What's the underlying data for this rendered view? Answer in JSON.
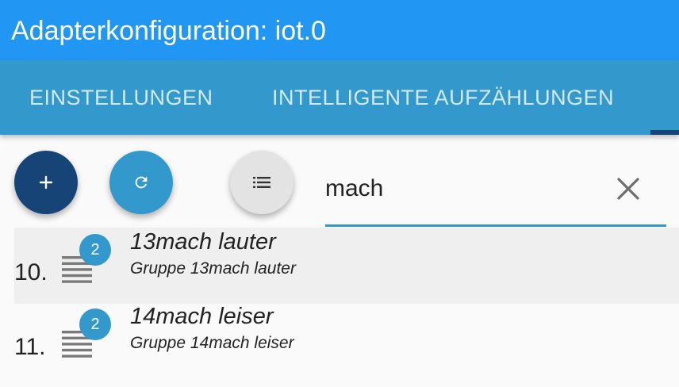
{
  "window": {
    "title": "Adapterkonfiguration: iot.0"
  },
  "tabs": [
    {
      "label": "EINSTELLUNGEN"
    },
    {
      "label": "INTELLIGENTE AUFZÄHLUNGEN"
    }
  ],
  "toolbar": {
    "add_icon": "plus-icon",
    "refresh_icon": "refresh-icon",
    "list_icon": "list-icon",
    "search_value": "mach",
    "clear_icon": "close-icon"
  },
  "list": {
    "items": [
      {
        "index": "10.",
        "badge": "2",
        "name": "13mach lauter",
        "description": "Gruppe 13mach lauter"
      },
      {
        "index": "11.",
        "badge": "2",
        "name": "14mach leiser",
        "description": "Gruppe 14mach leiser"
      }
    ]
  },
  "colors": {
    "title_bar": "#2196f3",
    "tab_bar": "#3399cc",
    "accent_dark": "#164477",
    "accent": "#3399cc",
    "badge": "#3399cc"
  }
}
